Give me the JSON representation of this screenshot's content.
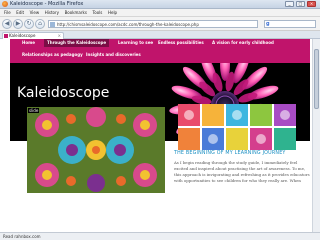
{
  "window": {
    "title": "Kaleidoscope - Mozilla Firefox",
    "minimize": "_",
    "maximize": "□",
    "close": "×"
  },
  "menubar": [
    "File",
    "Edit",
    "View",
    "History",
    "Bookmarks",
    "Tools",
    "Help"
  ],
  "navigation": {
    "back": "◀",
    "forward": "▶",
    "reload": "↻",
    "stop": "✕",
    "home": "⌂",
    "url": "http://chismsaleidoscope.com/acdc.com/through-the-kaleidoscope.php",
    "search_icon": "g"
  },
  "tab": {
    "label": "Kaleidoscope",
    "close": "×"
  },
  "site": {
    "title": "Kaleidoscope",
    "menu": [
      "Home",
      "Through the Kaleidoscope",
      "Learning to see",
      "Endless possibilities",
      "A vision for early childhood",
      "Relationships as pedagogy",
      "Insights and discoveries"
    ],
    "accent": "#c0146b",
    "active_menu": "#7a0d45"
  },
  "post": {
    "image_label": "slide",
    "title": "THE BEGINNING OF MY LEARNING JOURNEY",
    "body": [
      "As I begin reading through the study guide, I immediately feel",
      "excited and inspired about practising the art of awareness. To me,",
      "this approach is invigorating and refreshing as it provides educators",
      "with opportunities to see children for who they really are. When"
    ]
  },
  "status": "Read rahnbox.com"
}
